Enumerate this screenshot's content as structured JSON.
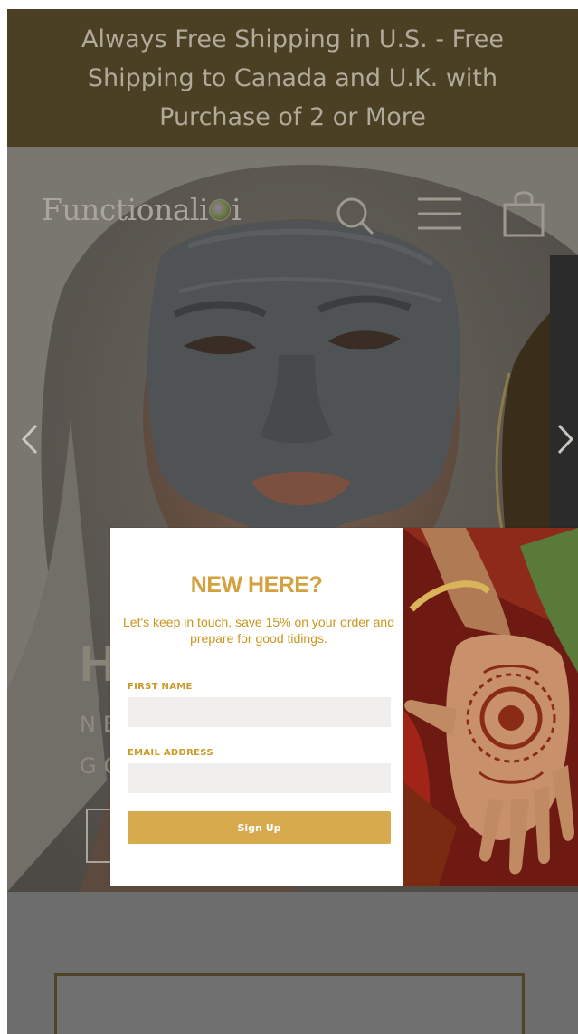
{
  "announcement": {
    "text": "Always Free Shipping in U.S. - Free Shipping to Canada and U.K. with Purchase of 2 or More"
  },
  "header": {
    "logo_text_left": "Functionali",
    "logo_text_right": "i",
    "icons": [
      "search-icon",
      "menu-icon",
      "cart-icon"
    ]
  },
  "hero": {
    "title_partial": "He",
    "subtitle_line1": "NE",
    "subtitle_line2": "GO",
    "prev_icon": "chevron-left-icon",
    "next_icon": "chevron-right-icon"
  },
  "popup": {
    "title": "NEW HERE?",
    "description": "Let's keep in touch, save 15% on your order and prepare for good tidings.",
    "first_name_label": "FIRST NAME",
    "first_name_value": "",
    "email_label": "EMAIL ADDRESS",
    "email_value": "",
    "submit_label": "Sign Up"
  },
  "colors": {
    "announcement_bg": "#4b3f24",
    "popup_accent": "#d4a13f",
    "button_bg": "#d7aa4e",
    "overlay": "#6e6e6e"
  }
}
